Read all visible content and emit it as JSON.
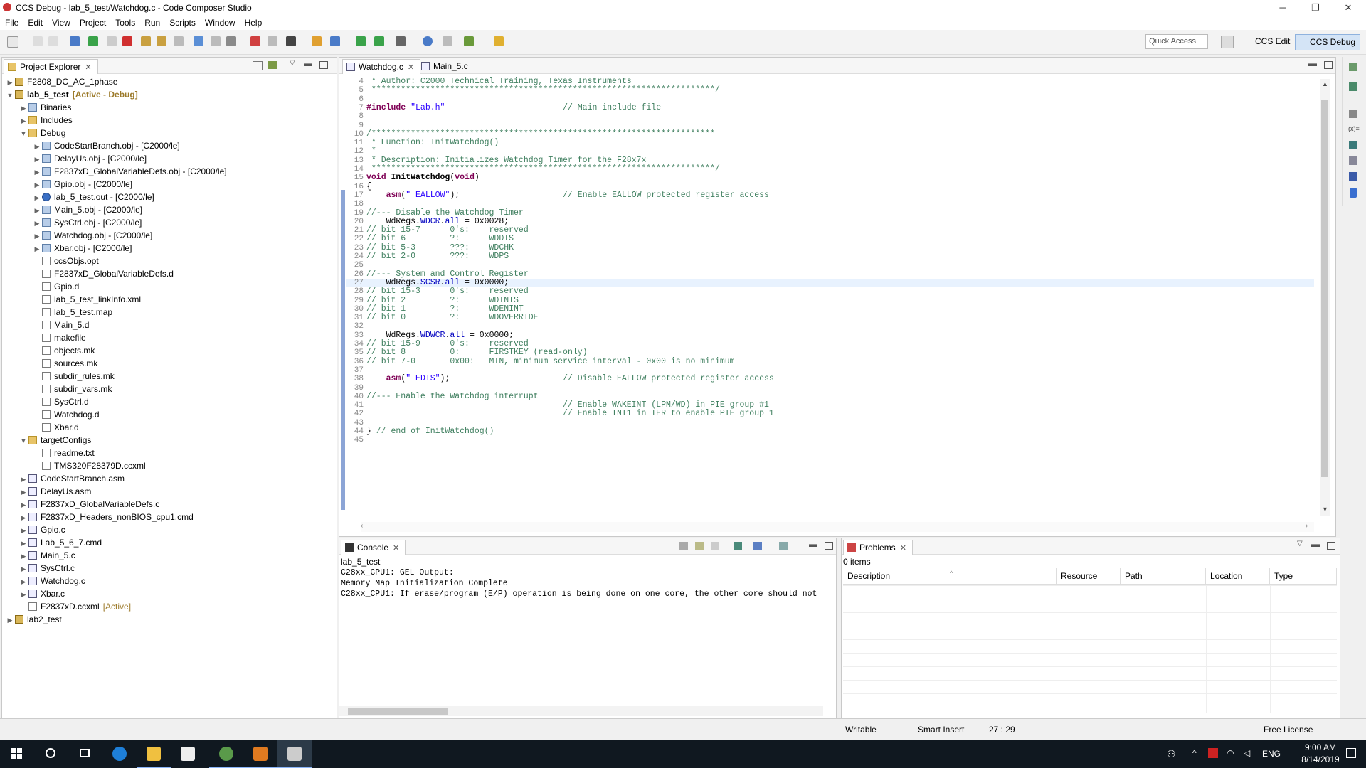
{
  "window": {
    "title": "CCS Debug - lab_5_test/Watchdog.c - Code Composer Studio",
    "minimize": "─",
    "maximize": "❐",
    "close": "✕"
  },
  "menu": [
    "File",
    "Edit",
    "View",
    "Project",
    "Tools",
    "Run",
    "Scripts",
    "Window",
    "Help"
  ],
  "toolbar": {
    "quick_access_placeholder": "Quick Access",
    "perspectives": [
      "CCS Edit",
      "CCS Debug"
    ]
  },
  "project_explorer": {
    "title": "Project Explorer",
    "items": [
      {
        "depth": 0,
        "arrow": ">",
        "icon": "proj",
        "label": "F2808_DC_AC_1phase",
        "tag": ""
      },
      {
        "depth": 0,
        "arrow": "v",
        "icon": "proj",
        "label": "lab_5_test",
        "tag": "[Active - Debug]",
        "bold": true
      },
      {
        "depth": 1,
        "arrow": ">",
        "icon": "bin",
        "label": "Binaries",
        "tag": ""
      },
      {
        "depth": 1,
        "arrow": ">",
        "icon": "folder",
        "label": "Includes",
        "tag": ""
      },
      {
        "depth": 1,
        "arrow": "v",
        "icon": "folder",
        "label": "Debug",
        "tag": ""
      },
      {
        "depth": 2,
        "arrow": ">",
        "icon": "bin",
        "label": "CodeStartBranch.obj - [C2000/le]",
        "tag": ""
      },
      {
        "depth": 2,
        "arrow": ">",
        "icon": "bin",
        "label": "DelayUs.obj - [C2000/le]",
        "tag": ""
      },
      {
        "depth": 2,
        "arrow": ">",
        "icon": "bin",
        "label": "F2837xD_GlobalVariableDefs.obj - [C2000/le]",
        "tag": ""
      },
      {
        "depth": 2,
        "arrow": ">",
        "icon": "bin",
        "label": "Gpio.obj - [C2000/le]",
        "tag": ""
      },
      {
        "depth": 2,
        "arrow": ">",
        "icon": "out",
        "label": "lab_5_test.out - [C2000/le]",
        "tag": ""
      },
      {
        "depth": 2,
        "arrow": ">",
        "icon": "bin",
        "label": "Main_5.obj - [C2000/le]",
        "tag": ""
      },
      {
        "depth": 2,
        "arrow": ">",
        "icon": "bin",
        "label": "SysCtrl.obj - [C2000/le]",
        "tag": ""
      },
      {
        "depth": 2,
        "arrow": ">",
        "icon": "bin",
        "label": "Watchdog.obj - [C2000/le]",
        "tag": ""
      },
      {
        "depth": 2,
        "arrow": ">",
        "icon": "bin",
        "label": "Xbar.obj - [C2000/le]",
        "tag": ""
      },
      {
        "depth": 2,
        "arrow": "",
        "icon": "file",
        "label": "ccsObjs.opt",
        "tag": ""
      },
      {
        "depth": 2,
        "arrow": "",
        "icon": "file",
        "label": "F2837xD_GlobalVariableDefs.d",
        "tag": ""
      },
      {
        "depth": 2,
        "arrow": "",
        "icon": "file",
        "label": "Gpio.d",
        "tag": ""
      },
      {
        "depth": 2,
        "arrow": "",
        "icon": "file",
        "label": "lab_5_test_linkInfo.xml",
        "tag": ""
      },
      {
        "depth": 2,
        "arrow": "",
        "icon": "file",
        "label": "lab_5_test.map",
        "tag": ""
      },
      {
        "depth": 2,
        "arrow": "",
        "icon": "file",
        "label": "Main_5.d",
        "tag": ""
      },
      {
        "depth": 2,
        "arrow": "",
        "icon": "file",
        "label": "makefile",
        "tag": ""
      },
      {
        "depth": 2,
        "arrow": "",
        "icon": "file",
        "label": "objects.mk",
        "tag": ""
      },
      {
        "depth": 2,
        "arrow": "",
        "icon": "file",
        "label": "sources.mk",
        "tag": ""
      },
      {
        "depth": 2,
        "arrow": "",
        "icon": "file",
        "label": "subdir_rules.mk",
        "tag": ""
      },
      {
        "depth": 2,
        "arrow": "",
        "icon": "file",
        "label": "subdir_vars.mk",
        "tag": ""
      },
      {
        "depth": 2,
        "arrow": "",
        "icon": "file",
        "label": "SysCtrl.d",
        "tag": ""
      },
      {
        "depth": 2,
        "arrow": "",
        "icon": "file",
        "label": "Watchdog.d",
        "tag": ""
      },
      {
        "depth": 2,
        "arrow": "",
        "icon": "file",
        "label": "Xbar.d",
        "tag": ""
      },
      {
        "depth": 1,
        "arrow": "v",
        "icon": "folder",
        "label": "targetConfigs",
        "tag": ""
      },
      {
        "depth": 2,
        "arrow": "",
        "icon": "file",
        "label": "readme.txt",
        "tag": ""
      },
      {
        "depth": 2,
        "arrow": "",
        "icon": "file",
        "label": "TMS320F28379D.ccxml",
        "tag": ""
      },
      {
        "depth": 1,
        "arrow": ">",
        "icon": "c",
        "label": "CodeStartBranch.asm",
        "tag": ""
      },
      {
        "depth": 1,
        "arrow": ">",
        "icon": "c",
        "label": "DelayUs.asm",
        "tag": ""
      },
      {
        "depth": 1,
        "arrow": ">",
        "icon": "c",
        "label": "F2837xD_GlobalVariableDefs.c",
        "tag": ""
      },
      {
        "depth": 1,
        "arrow": ">",
        "icon": "c",
        "label": "F2837xD_Headers_nonBIOS_cpu1.cmd",
        "tag": ""
      },
      {
        "depth": 1,
        "arrow": ">",
        "icon": "c",
        "label": "Gpio.c",
        "tag": ""
      },
      {
        "depth": 1,
        "arrow": ">",
        "icon": "c",
        "label": "Lab_5_6_7.cmd",
        "tag": ""
      },
      {
        "depth": 1,
        "arrow": ">",
        "icon": "c",
        "label": "Main_5.c",
        "tag": ""
      },
      {
        "depth": 1,
        "arrow": ">",
        "icon": "c",
        "label": "SysCtrl.c",
        "tag": ""
      },
      {
        "depth": 1,
        "arrow": ">",
        "icon": "c",
        "label": "Watchdog.c",
        "tag": ""
      },
      {
        "depth": 1,
        "arrow": ">",
        "icon": "c",
        "label": "Xbar.c",
        "tag": ""
      },
      {
        "depth": 1,
        "arrow": "",
        "icon": "file",
        "label": "F2837xD.ccxml",
        "tag": "[Active]"
      },
      {
        "depth": 0,
        "arrow": ">",
        "icon": "proj",
        "label": "lab2_test",
        "tag": ""
      }
    ]
  },
  "editor": {
    "tabs": [
      "Watchdog.c",
      "Main_5.c"
    ],
    "active_tab": "Watchdog.c",
    "cursor_line": 27,
    "lines": [
      {
        "n": "4",
        "t": " * Author: C2000 Technical Training, Texas Instruments",
        "c": "cm"
      },
      {
        "n": "5",
        "t": " **********************************************************************/",
        "c": "cm"
      },
      {
        "n": "6",
        "t": "",
        "c": ""
      },
      {
        "n": "7",
        "t": "#include \"Lab.h\"                        // Main include file",
        "c": "inc"
      },
      {
        "n": "8",
        "t": "",
        "c": ""
      },
      {
        "n": "9",
        "t": "",
        "c": ""
      },
      {
        "n": "10",
        "t": "/**********************************************************************",
        "c": "cm"
      },
      {
        "n": "11",
        "t": " * Function: InitWatchdog()",
        "c": "cm"
      },
      {
        "n": "12",
        "t": " *",
        "c": "cm"
      },
      {
        "n": "13",
        "t": " * Description: Initializes Watchdog Timer for the F28x7x",
        "c": "cm"
      },
      {
        "n": "14",
        "t": " **********************************************************************/",
        "c": "cm"
      },
      {
        "n": "15",
        "t": "void InitWatchdog(void)",
        "c": "fndecl"
      },
      {
        "n": "16",
        "t": "{",
        "c": ""
      },
      {
        "n": "17",
        "t": "    asm(\" EALLOW\");                     // Enable EALLOW protected register access",
        "c": "asm"
      },
      {
        "n": "18",
        "t": "",
        "c": ""
      },
      {
        "n": "19",
        "t": "//--- Disable the Watchdog Timer",
        "c": "cm"
      },
      {
        "n": "20",
        "t": "    WdRegs.WDCR.all = 0x0028;",
        "c": "reg"
      },
      {
        "n": "21",
        "t": "// bit 15-7      0's:    reserved",
        "c": "cm"
      },
      {
        "n": "22",
        "t": "// bit 6         ?:      WDDIS",
        "c": "cm"
      },
      {
        "n": "23",
        "t": "// bit 5-3       ???:    WDCHK",
        "c": "cm"
      },
      {
        "n": "24",
        "t": "// bit 2-0       ???:    WDPS",
        "c": "cm"
      },
      {
        "n": "25",
        "t": "",
        "c": ""
      },
      {
        "n": "26",
        "t": "//--- System and Control Register",
        "c": "cm"
      },
      {
        "n": "27",
        "t": "    WdRegs.SCSR.all = 0x0000;",
        "c": "reg"
      },
      {
        "n": "28",
        "t": "// bit 15-3      0's:    reserved",
        "c": "cm"
      },
      {
        "n": "29",
        "t": "// bit 2         ?:      WDINTS",
        "c": "cm"
      },
      {
        "n": "30",
        "t": "// bit 1         ?:      WDENINT",
        "c": "cm"
      },
      {
        "n": "31",
        "t": "// bit 0         ?:      WDOVERRIDE",
        "c": "cm"
      },
      {
        "n": "32",
        "t": "",
        "c": ""
      },
      {
        "n": "33",
        "t": "    WdRegs.WDWCR.all = 0x0000;",
        "c": "reg"
      },
      {
        "n": "34",
        "t": "// bit 15-9      0's:    reserved",
        "c": "cm"
      },
      {
        "n": "35",
        "t": "// bit 8         0:      FIRSTKEY (read-only)",
        "c": "cm"
      },
      {
        "n": "36",
        "t": "// bit 7-0       0x00:   MIN, minimum service interval - 0x00 is no minimum",
        "c": "cm"
      },
      {
        "n": "37",
        "t": "",
        "c": ""
      },
      {
        "n": "38",
        "t": "    asm(\" EDIS\");                       // Disable EALLOW protected register access",
        "c": "asm"
      },
      {
        "n": "39",
        "t": "",
        "c": ""
      },
      {
        "n": "40",
        "t": "//--- Enable the Watchdog interrupt",
        "c": "cm"
      },
      {
        "n": "41",
        "t": "                                        // Enable WAKEINT (LPM/WD) in PIE group #1",
        "c": "cm"
      },
      {
        "n": "42",
        "t": "                                        // Enable INT1 in IER to enable PIE group 1",
        "c": "cm"
      },
      {
        "n": "43",
        "t": "",
        "c": ""
      },
      {
        "n": "44",
        "t": "} // end of InitWatchdog()",
        "c": "end"
      },
      {
        "n": "45",
        "t": "",
        "c": ""
      }
    ]
  },
  "console": {
    "title": "Console",
    "subtitle": "lab_5_test",
    "lines": [
      "C28xx_CPU1: GEL Output:",
      "Memory Map Initialization Complete",
      "C28xx_CPU1: If erase/program (E/P) operation is being done on one core, the other core should not"
    ]
  },
  "problems": {
    "title": "Problems",
    "count": "0 items",
    "columns": [
      "Description",
      "Resource",
      "Path",
      "Location",
      "Type"
    ]
  },
  "status": {
    "writable": "Writable",
    "insert_mode": "Smart Insert",
    "position": "27 : 29",
    "license": "Free License"
  },
  "taskbar": {
    "time": "9:00 AM",
    "date": "8/14/2019",
    "lang": "ENG"
  },
  "colors": {
    "comment": "#3f7f5f",
    "keyword": "#7f0055",
    "string": "#2a00ff",
    "field": "#0000c0",
    "taskbar": "#101820"
  }
}
